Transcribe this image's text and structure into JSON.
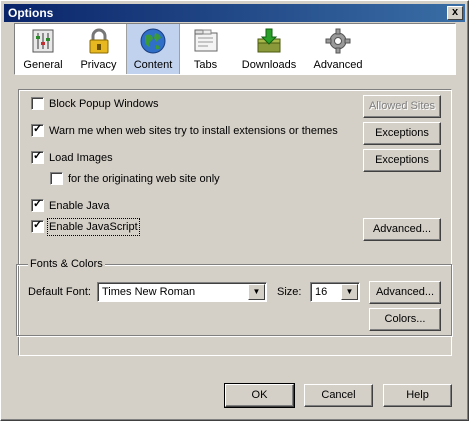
{
  "window": {
    "title": "Options",
    "close_glyph": "x"
  },
  "toolbar": [
    {
      "label": "General",
      "icon": "general-icon"
    },
    {
      "label": "Privacy",
      "icon": "lock-icon"
    },
    {
      "label": "Content",
      "icon": "globe-icon",
      "active": true
    },
    {
      "label": "Tabs",
      "icon": "tabs-icon"
    },
    {
      "label": "Downloads",
      "icon": "download-icon"
    },
    {
      "label": "Advanced",
      "icon": "gear-icon"
    }
  ],
  "content": {
    "block_popups": {
      "label": "Block Popup Windows",
      "checked": false
    },
    "warn_extensions": {
      "label": "Warn me when web sites try to install extensions or themes",
      "checked": true
    },
    "load_images": {
      "label": "Load Images",
      "checked": true
    },
    "originating_only": {
      "label": "for the originating web site only",
      "checked": false
    },
    "enable_java": {
      "label": "Enable Java",
      "checked": true
    },
    "enable_js": {
      "label": "Enable JavaScript",
      "checked": true
    },
    "allowed_sites_button": "Allowed Sites",
    "exceptions_button_1": "Exceptions",
    "exceptions_button_2": "Exceptions",
    "advanced_js_button": "Advanced..."
  },
  "fonts": {
    "group_label": "Fonts & Colors",
    "default_font_label": "Default Font:",
    "default_font_value": "Times New Roman",
    "size_label": "Size:",
    "size_value": "16",
    "advanced_button": "Advanced...",
    "colors_button": "Colors..."
  },
  "footer": {
    "ok": "OK",
    "cancel": "Cancel",
    "help": "Help"
  },
  "colors": {
    "titlebar": "#0a246a",
    "face": "#d4d0c8",
    "active_tab": "#c1d2ee"
  }
}
